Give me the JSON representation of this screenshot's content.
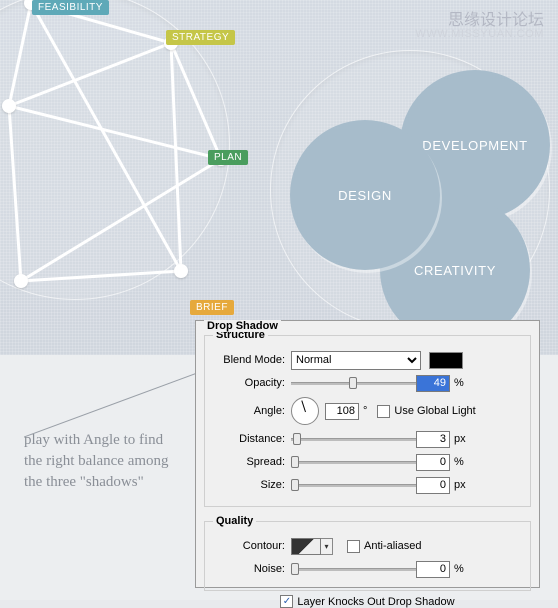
{
  "watermark": {
    "cn": "思缘设计论坛",
    "en": "WWW.MISSYUAN.COM"
  },
  "tags": {
    "feasibility": "FEASIBILITY",
    "strategy": "STRATEGY",
    "plan": "PLAN",
    "brief": "BRIEF"
  },
  "venn": {
    "design": "DESIGN",
    "development": "DEVELOPMENT",
    "creativity": "CREATIVITY"
  },
  "annotation": "play with Angle to find the right balance among the three \"shadows\"",
  "panel": {
    "title": "Drop Shadow",
    "structure": {
      "legend": "Structure",
      "blend_mode_label": "Blend Mode:",
      "blend_mode_value": "Normal",
      "swatch_color": "#000000",
      "opacity_label": "Opacity:",
      "opacity_value": "49",
      "opacity_unit": "%",
      "angle_label": "Angle:",
      "angle_value": "108",
      "angle_unit": "°",
      "global_light_label": "Use Global Light",
      "global_light_checked": false,
      "distance_label": "Distance:",
      "distance_value": "3",
      "distance_unit": "px",
      "spread_label": "Spread:",
      "spread_value": "0",
      "spread_unit": "%",
      "size_label": "Size:",
      "size_value": "0",
      "size_unit": "px"
    },
    "quality": {
      "legend": "Quality",
      "contour_label": "Contour:",
      "antialiased_label": "Anti-aliased",
      "antialiased_checked": false,
      "noise_label": "Noise:",
      "noise_value": "0",
      "noise_unit": "%"
    },
    "knockout": {
      "label": "Layer Knocks Out Drop Shadow",
      "checked": true
    }
  }
}
